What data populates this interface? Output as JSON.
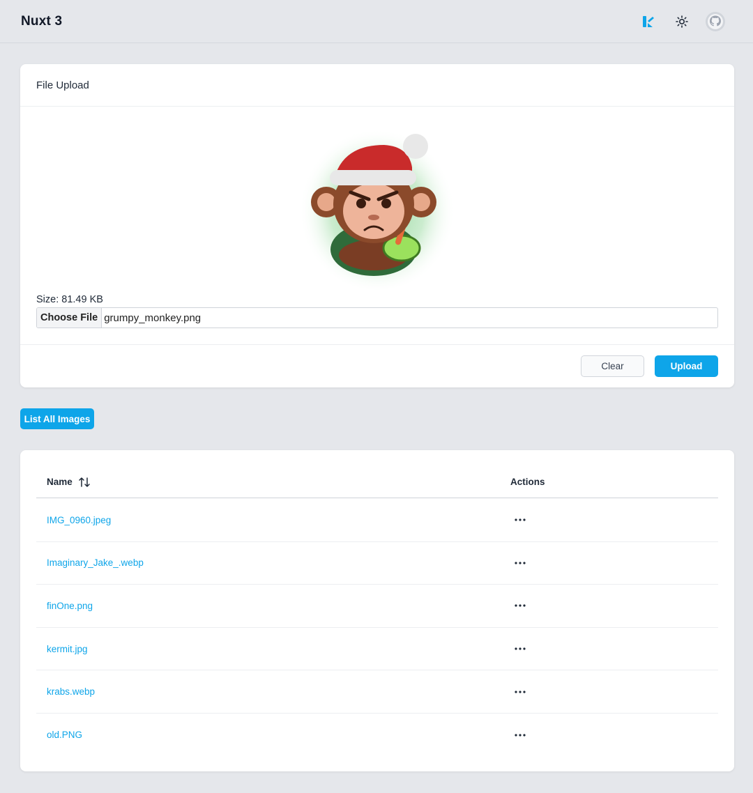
{
  "header": {
    "title": "Nuxt 3",
    "icons": [
      "nuxt-ui-logo-icon",
      "sun-icon",
      "github-icon"
    ],
    "accent_color": "#0ea5e9"
  },
  "upload_card": {
    "title": "File Upload",
    "preview_image": "grumpy-monkey-santa-hat-image",
    "size_text": "Size: 81.49 KB",
    "file_input": {
      "button_label": "Choose File",
      "file_name": "grumpy_monkey.png"
    },
    "clear_label": "Clear",
    "upload_label": "Upload"
  },
  "list_button_label": "List All Images",
  "table": {
    "columns": {
      "name": "Name",
      "actions": "Actions"
    },
    "sort_icon": "sort-arrows-icon",
    "row_action_icon": "ellipsis-icon",
    "rows": [
      {
        "name": "IMG_0960.jpeg"
      },
      {
        "name": "Imaginary_Jake_.webp"
      },
      {
        "name": "finOne.png"
      },
      {
        "name": "kermit.jpg"
      },
      {
        "name": "krabs.webp"
      },
      {
        "name": "old.PNG"
      }
    ]
  }
}
